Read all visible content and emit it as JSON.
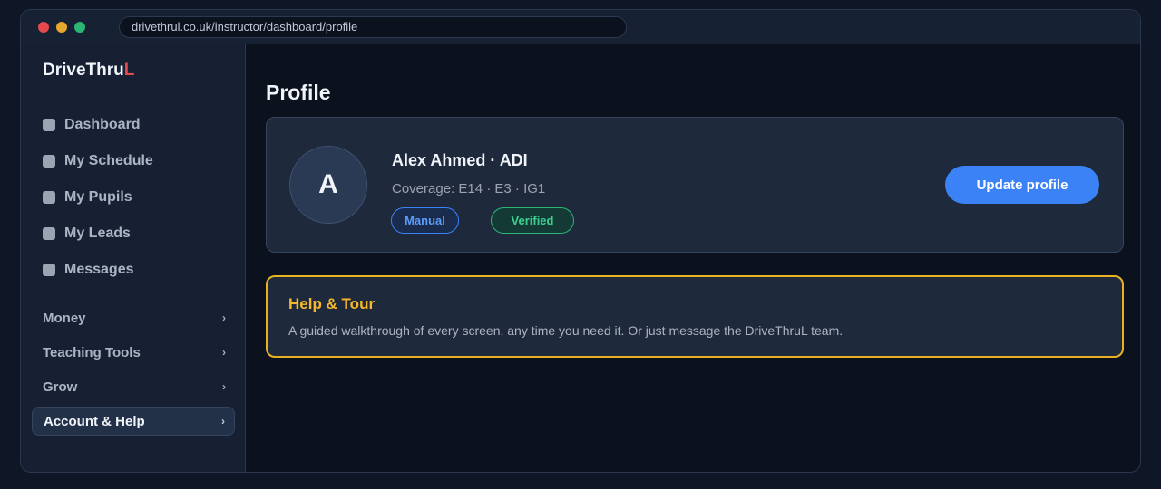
{
  "browser": {
    "url": "drivethrul.co.uk/instructor/dashboard/profile"
  },
  "sidebar": {
    "brand": "DriveThru",
    "brand_accent": "L",
    "items": [
      {
        "label": "Dashboard"
      },
      {
        "label": "My Schedule"
      },
      {
        "label": "My Pupils"
      },
      {
        "label": "My Leads"
      },
      {
        "label": "Messages"
      }
    ],
    "groups": [
      {
        "label": "Money",
        "chevron": "›"
      },
      {
        "label": "Teaching Tools",
        "chevron": "›"
      },
      {
        "label": "Grow",
        "chevron": "›"
      },
      {
        "label": "Account & Help",
        "chevron": "›",
        "active": true
      }
    ]
  },
  "main": {
    "title": "Profile",
    "profile": {
      "initial": "A",
      "name": "Alex Ahmed · ADI",
      "coverage": "Coverage: E14 · E3 · IG1",
      "badges": [
        "Manual",
        "Verified"
      ],
      "update_label": "Update profile"
    },
    "help": {
      "title": "Help & Tour",
      "text": "A guided walkthrough of every screen, any time you need it. Or just message the DriveThruL team."
    }
  },
  "colors": {
    "accent": "#3b82f6",
    "brand_red": "#e5484d",
    "success": "#2bb673",
    "warning": "#e8b123"
  },
  "icons": [
    "close-window-icon",
    "minimize-window-icon",
    "maximize-window-icon",
    "nav-square-icon",
    "chevron-right-icon"
  ]
}
